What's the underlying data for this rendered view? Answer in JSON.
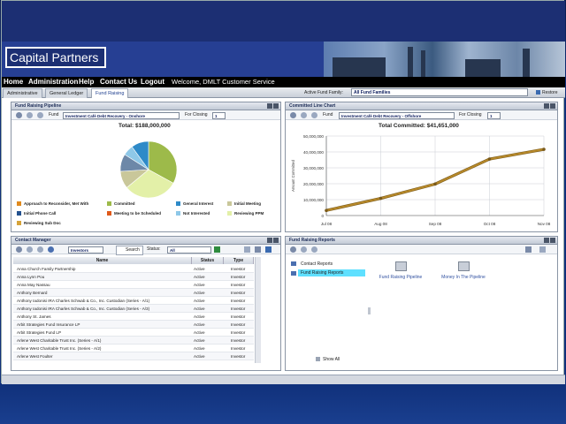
{
  "app": {
    "brand": "Capital Partners",
    "welcome": "Welcome, DMLT Customer Service"
  },
  "menu": {
    "items": [
      "Home",
      "Administration",
      "Help",
      "Contact Us",
      "Logout"
    ]
  },
  "tabs": {
    "items": [
      "Administrative",
      "General Ledger",
      "Fund Raising"
    ],
    "active": "Fund Raising"
  },
  "fund_family": {
    "label": "Active Fund Family:",
    "value": "All Fund Families",
    "restore_label": "Restore"
  },
  "pipeline": {
    "title": "Fund Raising Pipeline",
    "fund_label": "Fund",
    "fund_value": "Investment Café Debt Recovery - Onshore",
    "for_closing_label": "For Closing",
    "for_closing_value": "1",
    "total": "Total: $188,000,000",
    "legend": [
      {
        "label": "Approach to Reconsider, Met With",
        "color": "#e08a1e"
      },
      {
        "label": "Committed",
        "color": "#9dba4a"
      },
      {
        "label": "General Interest",
        "color": "#2e8ac8"
      },
      {
        "label": "Initial Meeting",
        "color": "#c9c79a"
      },
      {
        "label": "Initial Phone Call",
        "color": "#23518f"
      },
      {
        "label": "Meeting to be Scheduled",
        "color": "#e05a1a"
      },
      {
        "label": "Not Interested",
        "color": "#8ec8e8"
      },
      {
        "label": "Reviewing PPM",
        "color": "#e3f0a8"
      },
      {
        "label": "Reviewing Sub Doc",
        "color": "#d6a33a"
      }
    ],
    "pie": [
      {
        "label": "Committed",
        "value": 33,
        "color": "#9dba4a"
      },
      {
        "label": "Reviewing PPM",
        "value": 31,
        "color": "#e3f0a8"
      },
      {
        "label": "Initial Meeting",
        "value": 10,
        "color": "#c9c79a"
      },
      {
        "label": "Initial Phone Call",
        "value": 10,
        "color": "#6d88a8"
      },
      {
        "label": "Not Interested",
        "value": 6,
        "color": "#8ec8e8"
      },
      {
        "label": "General Interest",
        "value": 10,
        "color": "#2e8ac8"
      }
    ]
  },
  "committed_chart": {
    "title": "Committed Line Chart",
    "fund_label": "Fund",
    "fund_value": "Investment Café Debt Recovery - Offshore",
    "for_closing_label": "For Closing",
    "for_closing_value": "1",
    "total": "Total Committed: $41,651,000"
  },
  "chart_data": {
    "type": "line",
    "title": "Total Committed: $41,651,000",
    "ylabel": "Amount Committed",
    "xlabel": "",
    "categories": [
      "Jul 08",
      "Aug 08",
      "Sep 08",
      "Oct 08",
      "Nov 08"
    ],
    "x": [
      "Jul 08",
      "Aug 08",
      "Sep 08",
      "Oct 08",
      "Nov 08"
    ],
    "values": [
      3200000,
      10800000,
      19800000,
      35500000,
      41651000
    ],
    "ylim": [
      0,
      50000000
    ],
    "yticks": [
      "50,000,000",
      "40,000,000",
      "30,000,000",
      "20,000,000",
      "10,000,000",
      "0"
    ],
    "grid": true,
    "line_color": "#b88a2a"
  },
  "contact_manager": {
    "title": "Contact Manager",
    "type_value": "Investors",
    "search_label": "Search",
    "status_label": "Status:",
    "status_value": "All",
    "columns": [
      "Name",
      "Status",
      "Type"
    ],
    "rows": [
      [
        "Anna Church Family Partnership",
        "Active",
        "Investor"
      ],
      [
        "Anna Lynn Pou",
        "Active",
        "Investor"
      ],
      [
        "Anna May Nassau",
        "Active",
        "Investor"
      ],
      [
        "Anthony Bernard",
        "Active",
        "Investor"
      ],
      [
        "Anthony Iadonisi IRA Charles Schwab & Co., Inc. Custodian (Series - A/1)",
        "Active",
        "Investor"
      ],
      [
        "Anthony Iadonisi IRA Charles Schwab & Co., Inc. Custodian (Series - A/3)",
        "Active",
        "Investor"
      ],
      [
        "Anthony St. James",
        "Active",
        "Investor"
      ],
      [
        "Arbit Strategies Fund Insurance LP",
        "Active",
        "Investor"
      ],
      [
        "Arbit Strategies Fund LP",
        "Active",
        "Investor"
      ],
      [
        "Arlene West Charitable Trust Inc. (Series - A/1)",
        "Active",
        "Investor"
      ],
      [
        "Arlene West Charitable Trust Inc. (Series - A/2)",
        "Active",
        "Investor"
      ],
      [
        "Arlene West Foulter",
        "Active",
        "Investor"
      ]
    ]
  },
  "reports": {
    "title": "Fund Raising Reports",
    "tree": [
      "Contact Reports",
      "Fund Raising Reports"
    ],
    "selected": "Fund Raising Reports",
    "show_all": "Show All",
    "tiles": [
      "Fund Raising Pipeline",
      "Money In The Pipeline"
    ]
  }
}
